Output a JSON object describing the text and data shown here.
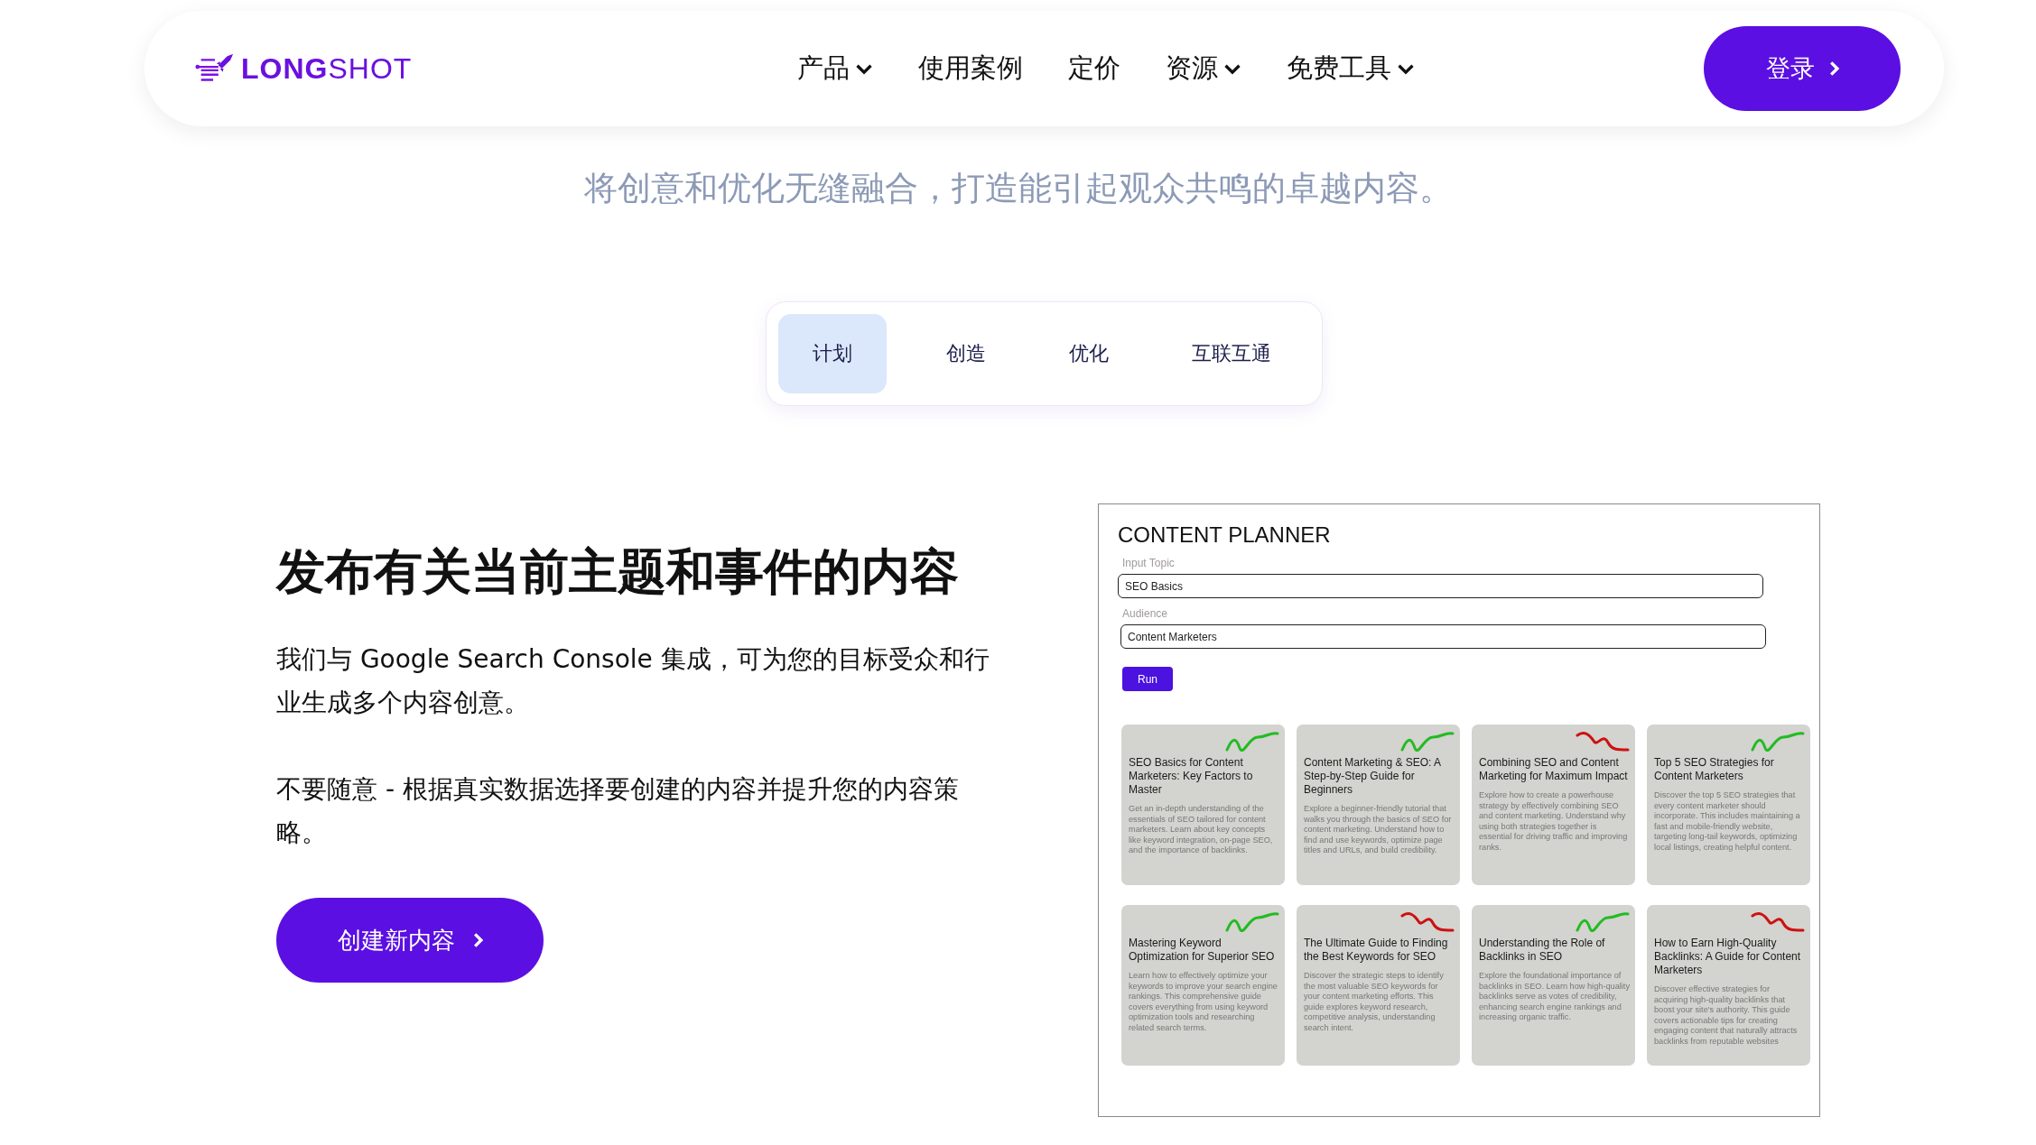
{
  "header": {
    "logo": "**LONG**SHOT",
    "nav": [
      {
        "label": "产品",
        "has_menu": true
      },
      {
        "label": "使用案例",
        "has_menu": false
      },
      {
        "label": "定价",
        "has_menu": false
      },
      {
        "label": "资源",
        "has_menu": true
      },
      {
        "label": "免费工具",
        "has_menu": true
      }
    ],
    "login_button": "登录"
  },
  "subtitle": "将创意和优化无缝融合，打造能引起观众共鸣的卓越内容。",
  "tabs": [
    {
      "label": "计划",
      "selected": true
    },
    {
      "label": "创造",
      "selected": false
    },
    {
      "label": "优化",
      "selected": false
    },
    {
      "label": "互联互通",
      "selected": false
    }
  ],
  "feature": {
    "heading": "发布有关当前主题和事件的内容",
    "paragraphs": [
      "我们与 Google Search Console 集成，可为您的目标受众和行业生成多个内容创意。",
      "不要随意 - 根据真实数据选择要创建的内容并提升您的内容策略。"
    ],
    "button": "创建新内容"
  },
  "planner": {
    "title": "CONTENT PLANNER",
    "fields": [
      {
        "label": "Input Topic",
        "value": "SEO Basics"
      },
      {
        "label": "Audience",
        "value": "Content Marketers"
      }
    ],
    "run_button": "Run",
    "cards": [
      {
        "title": "SEO Basics for Content Marketers: Key Factors to Master",
        "description": "Get an in-depth understanding of the essentials of SEO tailored for content marketers. Learn about key concepts like keyword integration, on-page SEO, and the importance of backlinks.",
        "color": "#22bb22"
      },
      {
        "title": "Content Marketing & SEO: A Step-by-Step Guide for Beginners",
        "description": "Explore a beginner-friendly tutorial that walks you through the basics of SEO for content marketing. Understand how to find and use keywords, optimize page titles and URLs, and build credibility.",
        "color": "#22bb22"
      },
      {
        "title": "Combining SEO and Content Marketing for Maximum Impact",
        "description": "Explore how to create a powerhouse strategy by effectively combining SEO and content marketing. Understand why using both strategies together is essential for driving traffic and improving ranks.",
        "color": "#cc1111"
      },
      {
        "title": "Top 5 SEO Strategies for Content Marketers",
        "description": "Discover the top 5 SEO strategies that every content marketer should incorporate. This includes maintaining a fast and mobile-friendly website, targeting long-tail keywords, optimizing local listings, creating helpful content.",
        "color": "#22bb22"
      },
      {
        "title": "Mastering Keyword Optimization for Superior SEO",
        "description": "Learn how to effectively optimize your keywords to improve your search engine rankings. This comprehensive guide covers everything from using keyword optimization tools and researching related search terms.",
        "color": "#22bb22"
      },
      {
        "title": "The Ultimate Guide to Finding the Best Keywords for SEO",
        "description": "Discover the strategic steps to identify the most valuable SEO keywords for your content marketing efforts. This guide explores keyword research, competitive analysis, understanding search intent.",
        "color": "#cc1111"
      },
      {
        "title": "Understanding the Role of Backlinks in SEO",
        "description": "Explore the foundational importance of backlinks in SEO. Learn how high-quality backlinks serve as votes of credibility, enhancing search engine rankings and increasing organic traffic.",
        "color": "#22bb22"
      },
      {
        "title": "How to Earn High-Quality Backlinks: A Guide for Content Marketers",
        "description": "Discover effective strategies for acquiring high-quality backlinks that boost your site's authority. This guide covers actionable tips for creating engaging content that naturally attracts backlinks from reputable websites",
        "color": "#cc1111"
      }
    ]
  }
}
